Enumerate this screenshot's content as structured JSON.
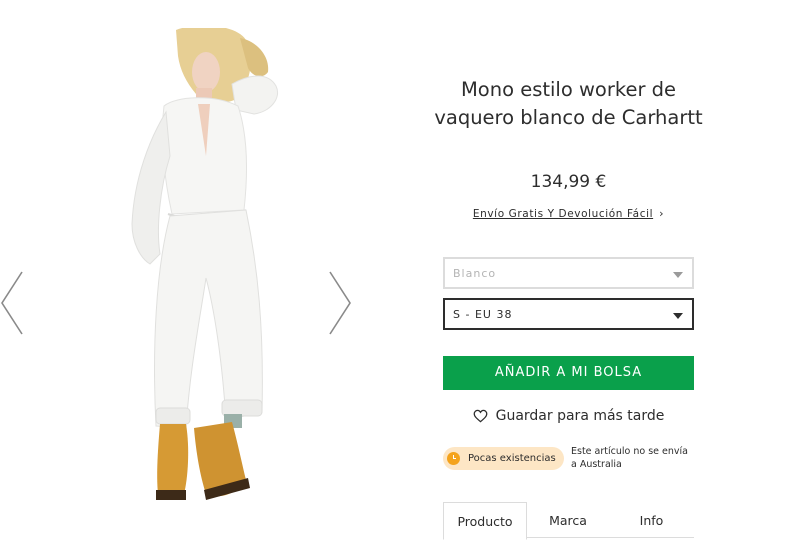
{
  "gallery": {
    "image_alt": "Modelo con mono blanco y botas amarillas",
    "prev_icon": "chevron-left-icon",
    "next_icon": "chevron-right-icon"
  },
  "product": {
    "title": "Mono estilo worker de vaquero blanco de Carhartt",
    "price": "134,99 €",
    "shipping_link": "Envío Gratis Y Devolución Fácil",
    "shipping_chevron": "›"
  },
  "options": {
    "colour_selected": "Blanco",
    "size_selected": "S - EU 38"
  },
  "actions": {
    "add_to_bag": "AÑADIR A MI BOLSA",
    "save_later": "Guardar para más tarde",
    "save_icon": "heart-icon"
  },
  "stock": {
    "badge": "Pocas existencias",
    "badge_color": "#fde6c5",
    "icon_color": "#f4a31c",
    "shipping_note": "Este artículo no se envía a Australia"
  },
  "tabs": [
    "Producto",
    "Marca",
    "Info"
  ],
  "colors": {
    "button": "#0aa04b",
    "text": "#2d2d2d",
    "border": "#dcdcdc"
  }
}
